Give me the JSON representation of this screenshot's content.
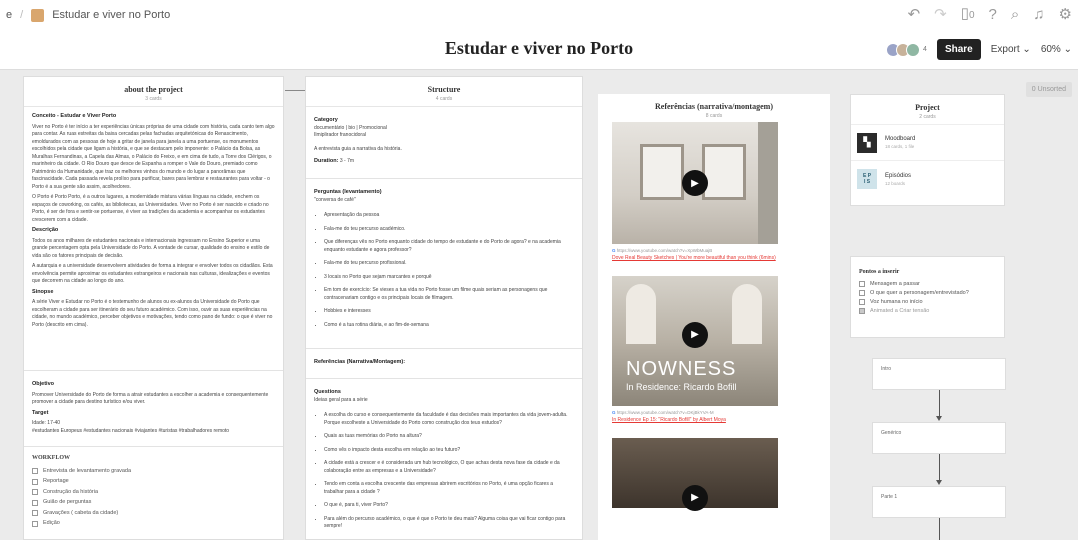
{
  "breadcrumb": {
    "prefix": "e",
    "separator": "/",
    "board_name": "Estudar e viver no Porto"
  },
  "header": {
    "title": "Estudar e viver no Porto",
    "avatars_count": "4",
    "share_label": "Share",
    "export_label": "Export",
    "zoom": "60%",
    "device_count": "0"
  },
  "unsorted_label": "0 Unsorted",
  "about": {
    "title": "about the project",
    "count": "3 cards",
    "concept_heading": "Conceito - Estudar e Viver Porto",
    "concept_p1": "Viver no Porto é ter início a ter experiências únicas próprias de uma cidade com história, cada canto tem algo para contar. As ruas estreitas da baixa cercadas pelas fachadas arquitetónicas do Renascimento, emoldurados com as pessoas de hoje a gritar de janela para janela a uma portuense, os monumentos escolhidos pela cidade que ligam a história, e que se destacam pelo imponente: o Palácio da Bolsa, as Muralhas Fernandinas, a Capela das Almas, o Palácio do Freixo, e em cima de tudo, a Torre dos Clérigos, o marinheiro da cidade. O Rio Douro que desce de Espanha a romper o Vale do Douro, premiado como Património da Humanidade, que traz os melhores vinhos do mundo e do lugar a panorâmas que fascinacidade. Cada passada revela prolíxo para purificar, bares para lembrar e restaurantes para voltar - o Porto é a sua gente são assim, acolhedores.",
    "concept_p2": "O Porto é Porto Porto, é a outros lugares, a modernidade mistura várias línguas na cidade, enchem os espaços de coworking, os cafés, as bibliotecas, as Universidades. Viver no Porto é ser nascido e criado no Porto, é ser de fora e sentir-se portuense, é viver as tradições da academia e acompanhar os estudantes crescerem com a cidade.",
    "desc_heading": "Descrição",
    "desc_p1": "Todos os anos milhares de estudantes nacionais e internacionais ingressam no Ensino Superior e uma grande percentagem opta pela Universidade do Porto. A vontade de cursar, qualidade do ensino e estilo de vida são os fatores principais de decisão.",
    "desc_p2": "A autarquia e a universidade desenvolvem atividades de forma a integrar e envolver todos os cidadãos. Esta envolvência permite aproximar os estudantes estrangeiros e nacionais nas culturas, idealizações e eventos que decorrem na cidade ao longo do ano.",
    "sinopse_heading": "Sinopse",
    "sinopse_p": "A série Viver e Estudar no Porto é o testemunho de alunos ou ex-alunos da Universidade do Porto que escolheram a cidade para ser itinerário do seu futuro académico. Com isso, ouvir as suas experiências na cidade, no mundo académico, perceber objetivos e motivações, tendo como pano de fundo: o que é viver no Porto (descrito em cima).",
    "objetivo_heading": "Objetivo",
    "objetivo_p": "Promover Universidade do Porto de forma a atrair estudantes a escolher a academia e consequentemente promover a cidade para destino turístico e/ou viver.",
    "target_heading": "Target",
    "target_p1": "Idade: 17-40",
    "target_p2": "#estudantes Europeus #estudantes nacionais #viajantes #turistas #trabalhadores remoto",
    "workflow_title": "WORKFLOW",
    "workflow_items": [
      "Entrevista de levantamento gravada",
      "Reportage",
      "Construção da história",
      "Guião de perguntas",
      "Gravações ( cabeta da cidade)",
      "Edição"
    ]
  },
  "structure": {
    "title": "Structure",
    "count": "4 cards",
    "category_label": "Category",
    "category_value": "documentário | bio | Promocional",
    "category_sub": "Ilmiplirador franocidoral",
    "interview_note": "A entrevista guia a narrativa da história.",
    "duration_label": "Duration:",
    "duration_value": "3 - 7m",
    "perguntas_title": "Perguntas (levantamento)",
    "perguntas_sub": "\"conversa de café\"",
    "perguntas": [
      "Apresentação da pessoa",
      "Fala-me do teu percurso académico.",
      "Que diferenças vês no Porto enquanto cidade do tempo de estudante e do Porto de agora? e na academia enquanto estudante e agora professor?",
      "Fala-me do teu percurso profissional.",
      "3 locais no Porto que sejam marcantes e porquê",
      "Em tom de exercício: Se vieses a tua vida no Porto fosse um filme quais seriam as personagens que contracenariam contigo e os principais locais de filmagem.",
      "Hobbies e interesses",
      "Como é a tua rotina diária, e ao fim-de-semana"
    ],
    "referencias_label": "Referências (Narrativa/Montagem):",
    "questions_title": "Questions",
    "questions_sub": "Ideias geral para a série",
    "questions": [
      "A escolha do curso e consequentemente da faculdade é das decisões mais importantes da vida jovem-adulta. Porque escolheste a Universidade do Porto como construção dos teus estudos?",
      "Quais as tuas memórias do Porto na altura?",
      "Como vês o impacto desta escolha em relação ao teu futuro?",
      "A cidade está a crescer e é considerada um hub tecnológico, O que achas desta nova fase da cidade e da colaboração entre as empresas e a Universidade?",
      "Tendo em conta a escolha crescente das empresas abrirem escritórios no Porto, é uma opção ficares a trabalhar para a cidade ?",
      "O que é, para ti, viver Porto?",
      "Para além do percurso académico, o que é que o Porto te deu mais? Alguma coisa que vai ficar contigo para sempre!"
    ]
  },
  "references": {
    "title": "Referências (narrativa/montagem)",
    "count": "8 cards",
    "items": [
      {
        "url": "https://www.youtube.com/watch?v=XpWbMuajB",
        "title": "Dove Real Beauty Sketches | You're more beautiful than you think (6mins)"
      },
      {
        "url": "https://www.youtube.com/watch?v=DKjBkYVA-M",
        "title": "In Residence Ep 15: \"Ricardo Bofill\" by Albert Moya",
        "overlay_brand": "NOWNESS",
        "overlay_sub": "In Residence: Ricardo Bofill"
      }
    ]
  },
  "project": {
    "title": "Project",
    "count": "2 cards",
    "boards": [
      {
        "name": "Moodboard",
        "meta": "18 cards, 1 file",
        "icon": "moodboard-icon"
      },
      {
        "name": "Episódios",
        "meta": "12 boards",
        "icon_text": "E P\nI S"
      }
    ]
  },
  "pontos": {
    "title": "Pontos a inserir",
    "items": [
      {
        "label": "Mensagem a passar",
        "checked": false
      },
      {
        "label": "O que quer a personagem/entrevistado?",
        "checked": false
      },
      {
        "label": "Voz humana no início",
        "checked": false
      },
      {
        "label": "Animated a Criar tensão",
        "checked": true
      }
    ]
  },
  "flow": {
    "steps": [
      "Intro",
      "Genérico",
      "Parte 1"
    ]
  }
}
